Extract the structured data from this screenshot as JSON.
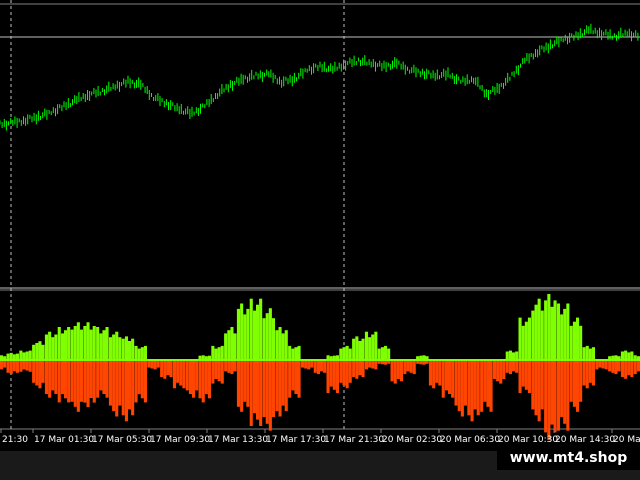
{
  "colors": {
    "background": "#000000",
    "candle": "#00ff00",
    "crosshair": "#c0c0c0",
    "separator": "#808080",
    "histogram_positive": "#7fff00",
    "histogram_negative": "#ff4500",
    "zero_line": "#7fff00",
    "label": "#ffffff"
  },
  "watermark": "www.mt4.shop",
  "time_axis": {
    "labels": [
      "21:30",
      "17 Mar 01:30",
      "17 Mar 05:30",
      "17 Mar 09:30",
      "17 Mar 13:30",
      "17 Mar 17:30",
      "17 Mar 21:30",
      "20 Mar 02:30",
      "20 Mar 06:30",
      "20 Mar 10:30",
      "20 Mar 14:30",
      "20 Mar"
    ]
  },
  "chart_data": [
    {
      "type": "line",
      "description_panel": "price",
      "x": [
        0,
        2,
        4,
        6,
        8,
        10,
        12,
        14,
        16,
        18,
        20,
        22,
        24,
        26,
        28,
        30,
        32,
        34,
        36,
        38,
        40,
        42,
        44,
        46,
        48,
        50,
        52,
        54,
        56,
        58,
        60,
        62,
        64,
        66,
        68,
        70,
        72,
        74,
        76,
        78,
        80,
        82,
        84,
        86,
        88,
        90,
        92,
        94,
        96,
        98,
        100
      ],
      "values": [
        30,
        31,
        33,
        35,
        38,
        42,
        46,
        50,
        52,
        55,
        58,
        56,
        48,
        44,
        40,
        37,
        42,
        50,
        56,
        60,
        62,
        63,
        58,
        60,
        66,
        68,
        66,
        70,
        72,
        70,
        68,
        70,
        66,
        64,
        62,
        63,
        58,
        60,
        50,
        54,
        62,
        72,
        78,
        82,
        86,
        88,
        92,
        90,
        88,
        90,
        88
      ],
      "ylim": [
        0,
        100
      ]
    },
    {
      "type": "bar",
      "description_panel": "histogram",
      "x": [
        0,
        2,
        4,
        6,
        8,
        10,
        12,
        14,
        16,
        18,
        20,
        22,
        24,
        26,
        28,
        30,
        32,
        34,
        36,
        38,
        40,
        42,
        44,
        46,
        48,
        50,
        52,
        54,
        56,
        58,
        60,
        62,
        64,
        66,
        68,
        70,
        72,
        74,
        76,
        78,
        80,
        82,
        84,
        86,
        88,
        90,
        92,
        94,
        96,
        98,
        100
      ],
      "positive": [
        2,
        3,
        4,
        8,
        12,
        14,
        16,
        16,
        14,
        12,
        10,
        6,
        0,
        0,
        0,
        0,
        2,
        6,
        14,
        24,
        26,
        22,
        14,
        6,
        0,
        0,
        2,
        6,
        10,
        12,
        6,
        0,
        0,
        2,
        0,
        0,
        0,
        0,
        0,
        0,
        4,
        18,
        26,
        28,
        24,
        18,
        6,
        0,
        2,
        4,
        2
      ],
      "negative": [
        4,
        6,
        5,
        12,
        16,
        18,
        22,
        20,
        16,
        24,
        26,
        18,
        4,
        8,
        12,
        16,
        18,
        10,
        6,
        22,
        28,
        30,
        24,
        16,
        4,
        6,
        14,
        12,
        8,
        4,
        2,
        10,
        6,
        2,
        12,
        16,
        24,
        26,
        22,
        10,
        6,
        14,
        26,
        34,
        30,
        22,
        12,
        4,
        6,
        8,
        6
      ],
      "ylim": [
        -40,
        40
      ]
    }
  ]
}
